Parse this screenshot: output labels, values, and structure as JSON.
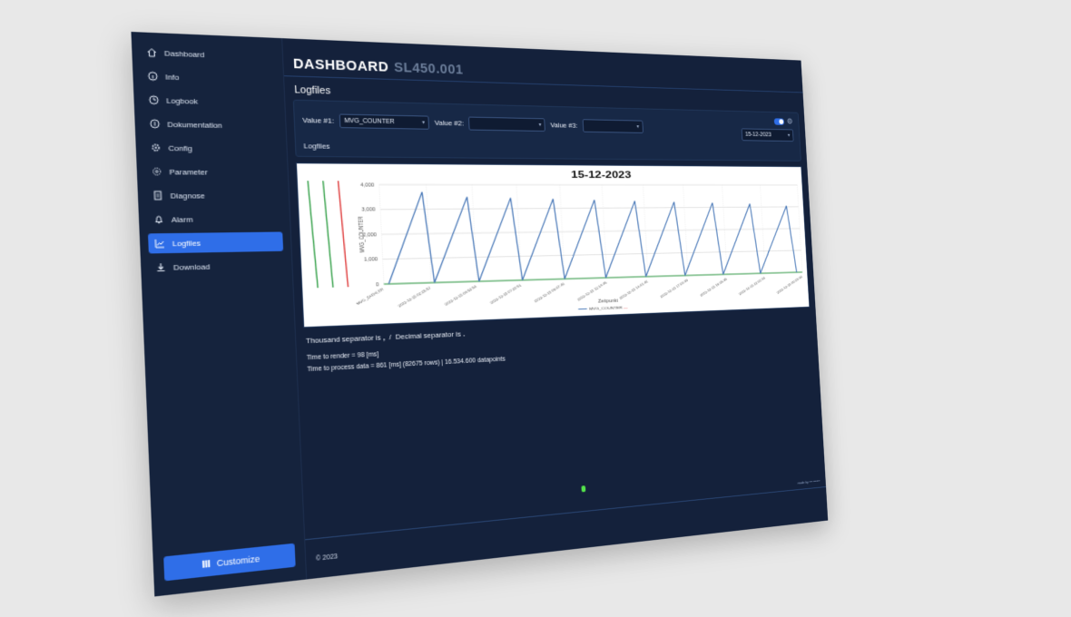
{
  "sidebar": {
    "items": [
      {
        "label": "Dashboard",
        "icon": "home-icon"
      },
      {
        "label": "Info",
        "icon": "info-icon"
      },
      {
        "label": "Logbook",
        "icon": "clock-icon"
      },
      {
        "label": "Dokumentation",
        "icon": "book-icon"
      },
      {
        "label": "Config",
        "icon": "gear-icon"
      },
      {
        "label": "Parameter",
        "icon": "sliders-icon"
      },
      {
        "label": "Diagnose",
        "icon": "document-icon"
      },
      {
        "label": "Alarm",
        "icon": "bell-icon"
      },
      {
        "label": "Logfiles",
        "icon": "chart-icon",
        "active": true
      },
      {
        "label": "Download",
        "icon": "download-icon"
      }
    ],
    "customize_label": "Customize"
  },
  "header": {
    "title": "DASHBOARD",
    "subtitle": "SL450.001"
  },
  "page": {
    "title": "Logfiles"
  },
  "filters": {
    "value1_label": "Value #1:",
    "value1_selected": "MVG_COUNTER",
    "value2_label": "Value #2:",
    "value2_selected": "",
    "value3_label": "Value #3:",
    "value3_selected": "",
    "date_value": "15-12-2023"
  },
  "section": {
    "title": "Logfiles"
  },
  "chart_data": {
    "type": "line",
    "title": "15-12-2023",
    "ylabel": "MVG_COUNTER",
    "xlabel": "Zeitpunkt",
    "ylim": [
      0,
      4000
    ],
    "yticks": [
      "4,000",
      "3,000",
      "2,000",
      "1,000",
      "0"
    ],
    "x": [
      "MVG_ZAEHLER",
      "2023-12-15 02:26:57",
      "2023-12-15 04:53:54",
      "2023-12-15 07:20:51",
      "2023-12-15 09:47:48",
      "2023-12-15 12:14:45",
      "2023-12-15 14:41:42",
      "2023-12-15 17:08:39",
      "2023-12-15 19:35:36",
      "2023-12-15 22:02:33",
      "2023-12-16 00:29:30"
    ],
    "series": [
      {
        "name": "MVG_COUNTER",
        "color": "#4a79b8",
        "peaks": [
          3700,
          3500,
          3450,
          3400,
          3350,
          3300,
          3250,
          3200,
          3150,
          3050
        ]
      }
    ],
    "legend": [
      "MVG_COUNTER",
      "—"
    ],
    "legend_position": "bottom",
    "grid": true
  },
  "info": {
    "thousand_label": "Thousand separator is",
    "thousand_value": ",",
    "divider": "/",
    "decimal_label": "Decimal separator is",
    "decimal_value": ".",
    "render_time": "Time to render = 98 [ms]",
    "process_time": "Time to process data = 861 [ms] (82675 rows) | 16.534.600 datapoints"
  },
  "footer": {
    "copyright": "© 2023",
    "credit": "made by ••• •••••••"
  }
}
